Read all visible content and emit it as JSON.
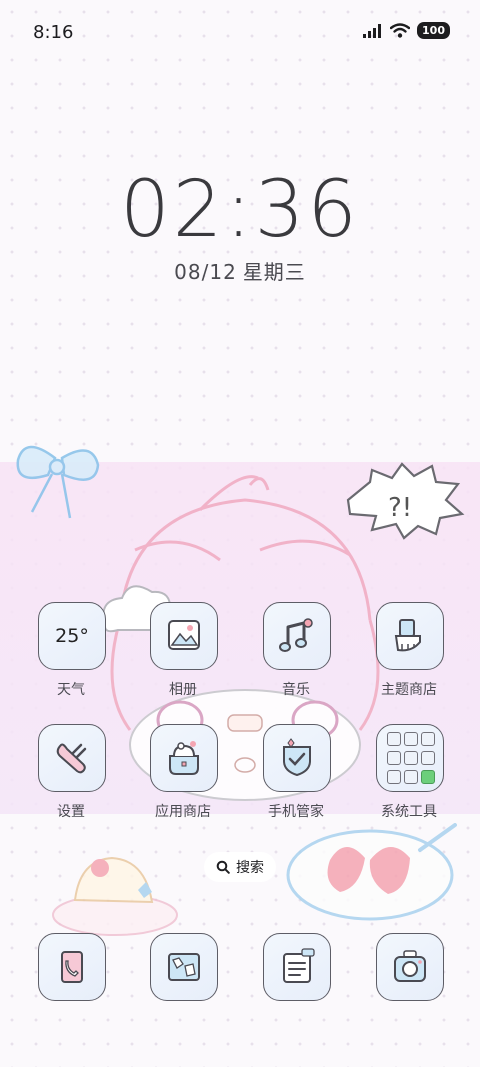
{
  "status_bar": {
    "time": "8:16",
    "battery": "100",
    "icons": [
      "signal-icon",
      "wifi-icon",
      "battery-icon"
    ]
  },
  "lock_clock": {
    "time": "02:36",
    "date": "08/12",
    "weekday": "星期三"
  },
  "apps": [
    {
      "name": "weather",
      "label": "天气",
      "temp": "25°",
      "icon": "weather-widget-icon"
    },
    {
      "name": "gallery",
      "label": "相册",
      "icon": "photo-frame-icon"
    },
    {
      "name": "music",
      "label": "音乐",
      "icon": "music-note-icon"
    },
    {
      "name": "theme-store",
      "label": "主题商店",
      "icon": "paint-brush-icon"
    },
    {
      "name": "settings",
      "label": "设置",
      "icon": "wrench-icon"
    },
    {
      "name": "app-store",
      "label": "应用商店",
      "icon": "shopping-basket-icon"
    },
    {
      "name": "security",
      "label": "手机管家",
      "icon": "shield-check-icon"
    },
    {
      "name": "system-tools",
      "label": "系统工具",
      "icon": "folder-icon"
    }
  ],
  "search": {
    "label": "搜索",
    "icon": "search-icon"
  },
  "dock": [
    {
      "name": "phone",
      "icon": "phone-icon"
    },
    {
      "name": "maps",
      "icon": "map-icon"
    },
    {
      "name": "notes",
      "icon": "notes-icon"
    },
    {
      "name": "camera",
      "icon": "camera-icon"
    }
  ],
  "colors": {
    "background": "#fbf9fc",
    "icon_fill": "#eaf1fb",
    "icon_stroke": "#5d5d66",
    "wallpaper_pink": "#f3c6d6",
    "wallpaper_blue": "#a9d2ee",
    "text": "#4b4b52"
  }
}
